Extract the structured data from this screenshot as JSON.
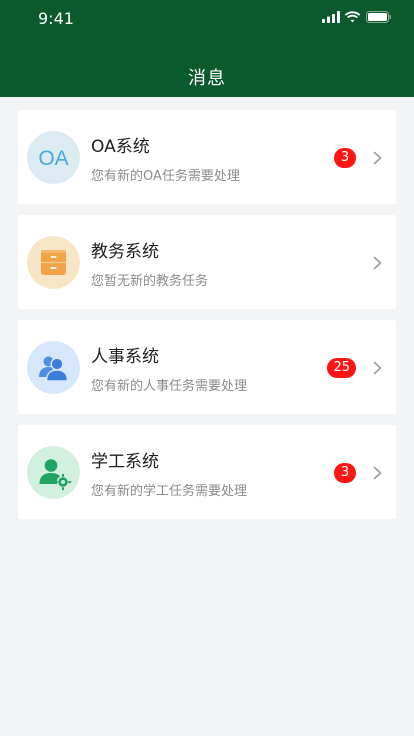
{
  "status_bar": {
    "time": "9:41"
  },
  "header": {
    "title": "消息"
  },
  "avatar_text": {
    "oa": "OA"
  },
  "messages": [
    {
      "title": "OA系统",
      "subtitle": "您有新的OA任务需要处理",
      "badge": "3",
      "icon": "oa-icon"
    },
    {
      "title": "教务系统",
      "subtitle": "您暂无新的教务任务",
      "badge": "",
      "icon": "archive-drawer-icon"
    },
    {
      "title": "人事系统",
      "subtitle": "您有新的人事任务需要处理",
      "badge": "25",
      "icon": "people-icon"
    },
    {
      "title": "学工系统",
      "subtitle": "您有新的学工任务需要处理",
      "badge": "3",
      "icon": "user-gear-icon"
    }
  ],
  "colors": {
    "header_bg": "#0b5a2c",
    "badge": "#ff1515",
    "page_bg": "#f3f4f6"
  }
}
